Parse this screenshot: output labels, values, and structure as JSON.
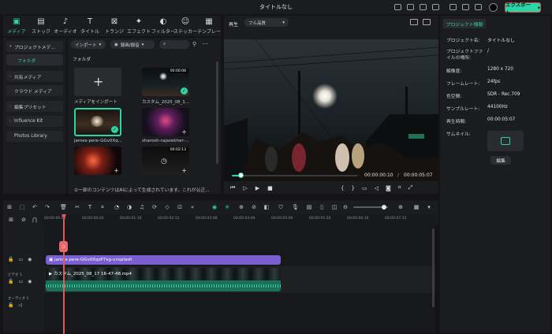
{
  "window": {
    "title": "タイトルなし",
    "export_label": "エクスポート"
  },
  "media_tabs": [
    {
      "label": "メディア",
      "icon": "media-icon"
    },
    {
      "label": "ストック",
      "icon": "stock-icon"
    },
    {
      "label": "オーディオ",
      "icon": "music-note-icon"
    },
    {
      "label": "タイトル",
      "icon": "text-icon"
    },
    {
      "label": "トランジ",
      "icon": "transition-icon"
    },
    {
      "label": "エフェクト",
      "icon": "effects-icon"
    },
    {
      "label": "フィルター",
      "icon": "filter-icon"
    },
    {
      "label": "ステッカー",
      "icon": "sticker-icon"
    },
    {
      "label": "テンプレー",
      "icon": "template-icon"
    }
  ],
  "sidebar": {
    "items": [
      {
        "label": "プロジェクトメデ..."
      },
      {
        "label": "フォルダ"
      },
      {
        "label": "共有メディア"
      },
      {
        "label": "クラウド メディア"
      },
      {
        "label": "編集プリセット"
      },
      {
        "label": "Influence Kit"
      },
      {
        "label": "Photos Library"
      }
    ]
  },
  "media": {
    "import_label": "インポート",
    "filter_label": "録画/録音",
    "search_placeholder": "",
    "folder_label": "フォルダ",
    "items": [
      {
        "label": "メディアをインポート",
        "duration": ""
      },
      {
        "label": "カスタム_2025_08_1...",
        "duration": "00:00:08"
      },
      {
        "label": "james-pere-GGv0Xq...",
        "duration": ""
      },
      {
        "label": "sharosh-rajasekher-...",
        "duration": ""
      },
      {
        "label": "",
        "duration": ""
      },
      {
        "label": "",
        "duration": "00:02:13"
      }
    ],
    "notice": "①一部のコンテンツはAIによって生成されています。これが公正..."
  },
  "player": {
    "tab_label": "再生",
    "quality_label": "フル品質",
    "current_time": "00:00:00:10",
    "total_time": "00:00:05:07",
    "progress": 0.07
  },
  "props": {
    "tab_label": "プロジェクト情報",
    "rows": [
      {
        "key": "プロジェクト名:",
        "value": "タイトルなし"
      },
      {
        "key": "プロジェクトファイルの場所:",
        "value": "/"
      },
      {
        "key": "解像度:",
        "value": "1280 x 720"
      },
      {
        "key": "フレームレート:",
        "value": "24fps"
      },
      {
        "key": "色空間:",
        "value": "SDR - Rec.709"
      },
      {
        "key": "サンプルレート:",
        "value": "44100Hz"
      },
      {
        "key": "再生時間:",
        "value": "00:00:05:07"
      },
      {
        "key": "サムネイル:",
        "value": ""
      }
    ],
    "edit_label": "編集"
  },
  "timeline": {
    "ticks": [
      "00:00:00:00",
      "00:00:00:20",
      "00:00:01:16",
      "00:00:02:12",
      "00:00:03:08",
      "00:00:04:04",
      "00:00:05:00",
      "00:00:05:20",
      "00:00:06:16",
      "00:00:07:12",
      "00:00:08:08"
    ],
    "clip_image": "james-pere-GGv0XqsP7xg-unsplash",
    "clip_video": "カスタム_2025_08_17 16-47-48.mp4",
    "video_track_label": "ビデオ 1",
    "audio_track_label": "オーディオ 1"
  },
  "colors": {
    "accent": "#2ad6a5",
    "clip_image": "#7a5fd0",
    "clip_video": "#2f3a3a"
  }
}
